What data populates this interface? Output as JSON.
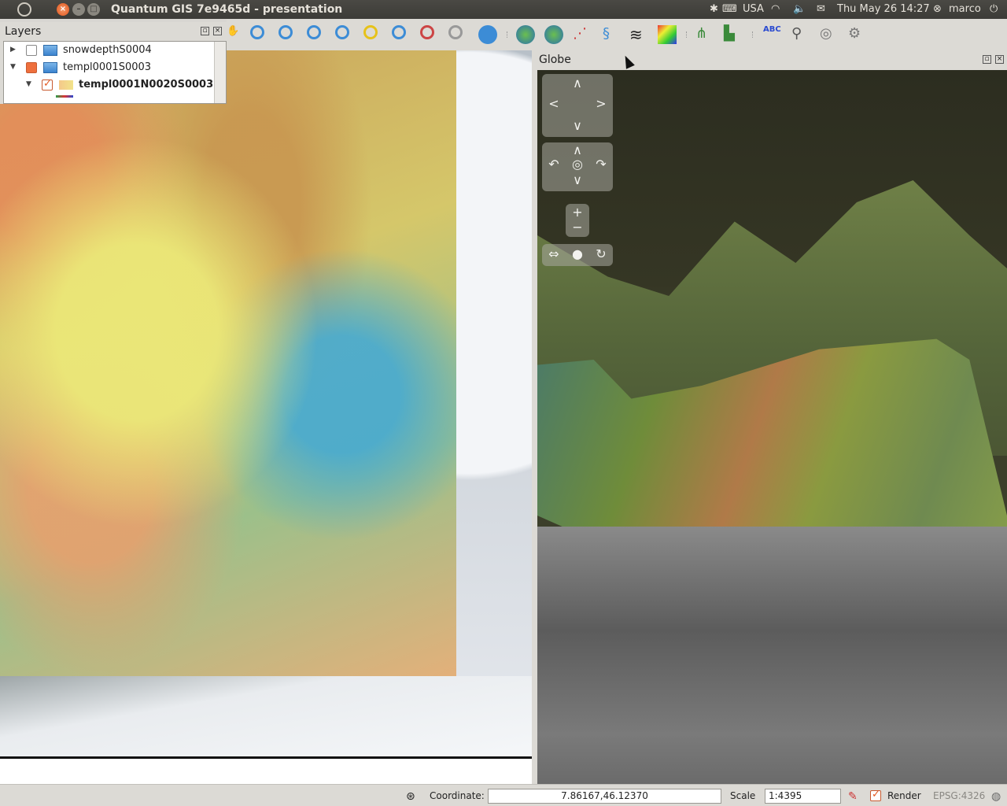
{
  "window": {
    "title": "Quantum GIS 7e9465d - presentation"
  },
  "panel": {
    "keyboard": "USA",
    "datetime": "Thu May 26 14:27",
    "user": "marco"
  },
  "layers_panel": {
    "title": "Layers",
    "items": [
      {
        "label": "snowdepthS0004",
        "checked": "unchecked",
        "type": "group"
      },
      {
        "label": "templ0001S0003",
        "checked": "partial",
        "type": "group"
      },
      {
        "label": "templ0001N0020S0003",
        "checked": "checked",
        "type": "raster"
      }
    ]
  },
  "toolbar": {
    "icons": [
      "pan-icon",
      "zoom-in-icon",
      "zoom-out-icon",
      "zoom-full-icon",
      "zoom-layer-icon",
      "zoom-selection-icon",
      "zoom-last-icon",
      "zoom-next-icon",
      "zoom-native-icon",
      "refresh-icon",
      "globe-icon",
      "globe-alt-icon",
      "graph-icon",
      "dna-icon",
      "layers-icon",
      "color-picker-icon",
      "chart-icon",
      "histogram-icon",
      "label-icon",
      "pin-icon",
      "ring-icon",
      "tools-icon"
    ]
  },
  "globe_panel": {
    "title": "Globe"
  },
  "statusbar": {
    "coordinate_label": "Coordinate:",
    "coordinate_value": "7.86167,46.12370",
    "scale_label": "Scale",
    "scale_value": "1:4395",
    "render_label": "Render",
    "crs": "EPSG:4326"
  },
  "colors": {
    "accent": "#e45a22",
    "panel_bg": "#3c3b37"
  }
}
